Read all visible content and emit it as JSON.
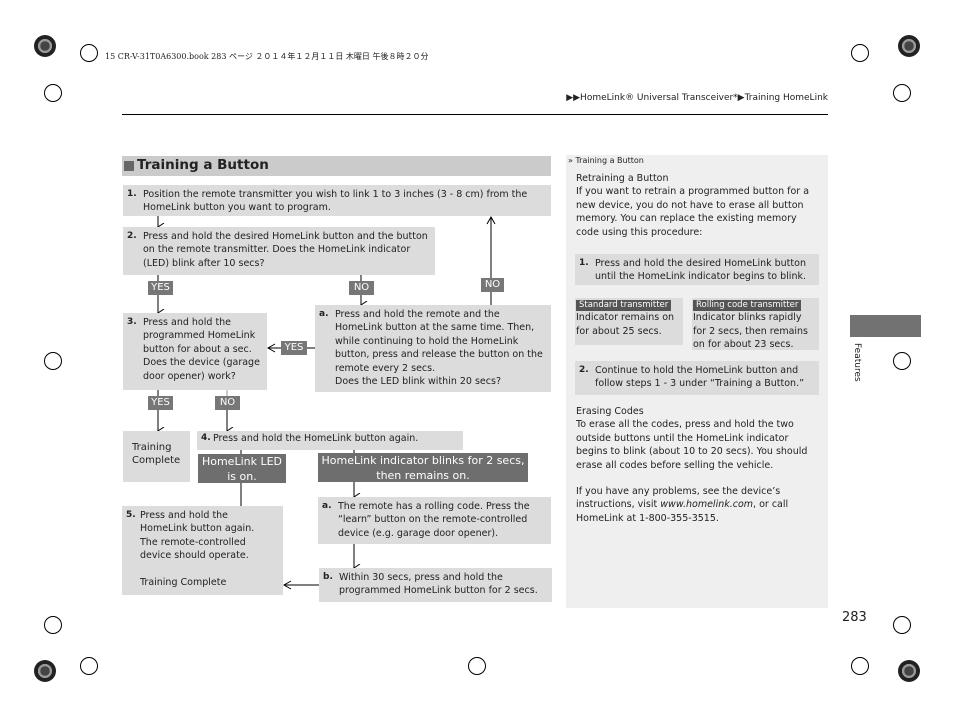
{
  "header": {
    "print_info": "15 CR-V-31T0A6300.book  283 ページ  ２０１４年１２月１１日  木曜日  午後８時２０分",
    "breadcrumb": "▶▶HomeLink® Universal Transceiver*▶Training HomeLink"
  },
  "section": {
    "title": "Training a Button"
  },
  "flow": {
    "step1": {
      "num": "1.",
      "text": "Position the remote transmitter you wish to link 1 to 3 inches (3 - 8 cm) from the HomeLink button you want to program."
    },
    "step2": {
      "num": "2.",
      "text": "Press and hold the desired HomeLink button and the button on the remote transmitter. Does the HomeLink indicator (LED) blink after 10 secs?"
    },
    "step2a": {
      "num": "a.",
      "text": "Press and hold the remote and the HomeLink button at the same time. Then, while continuing to hold the HomeLink button, press and release the button on the remote every 2 secs.",
      "question": "Does the LED blink within 20 secs?"
    },
    "step3": {
      "num": "3.",
      "text": "Press and hold the programmed HomeLink button for about a sec. Does the device (garage door opener) work?"
    },
    "training_complete": "Training Complete",
    "step4": {
      "num": "4.",
      "text": "Press and hold the HomeLink button again."
    },
    "led_on": "HomeLink LED is on.",
    "blinks": "HomeLink indicator blinks for 2 secs, then remains on.",
    "step5": {
      "num": "5.",
      "text1": "Press and hold the HomeLink button again.",
      "text2": "The remote-controlled device should operate.",
      "complete": "Training Complete"
    },
    "step4a": {
      "num": "a.",
      "text": "The remote has a rolling code. Press the “learn” button on the remote-controlled device (e.g. garage door opener)."
    },
    "step4b": {
      "num": "b.",
      "text": "Within 30 secs, press and hold the programmed HomeLink button for 2 secs."
    },
    "yes": "YES",
    "no": "NO"
  },
  "sidebar": {
    "ref": "Training a Button",
    "retrain_title": "Retraining a Button",
    "retrain_text": "If you want to retrain a programmed button for a new device, you do not have to erase all button memory. You can replace the existing memory code using this procedure:",
    "r1": {
      "num": "1.",
      "text": "Press and hold the desired HomeLink button until the HomeLink indicator begins to blink."
    },
    "standard": {
      "tag": "Standard transmitter",
      "text": "Indicator remains on for about 25 secs."
    },
    "rolling": {
      "tag": "Rolling code transmitter",
      "text": "Indicator blinks rapidly for 2 secs, then remains on for about 23 secs."
    },
    "r2": {
      "num": "2.",
      "text": "Continue to hold the HomeLink button and follow steps 1 - 3 under “Training a Button.”"
    },
    "erase_title": "Erasing Codes",
    "erase_text": "To erase all the codes, press and hold the two outside buttons until the HomeLink indicator begins to blink (about 10 to 20 secs). You should erase all codes before selling the vehicle.",
    "help_pre": "If you have any problems, see the device’s instructions, visit ",
    "help_url": "www.homelink.com",
    "help_post": ", or call HomeLink at 1-800-355-3515."
  },
  "chapter_tab": "Features",
  "page_number": "283"
}
